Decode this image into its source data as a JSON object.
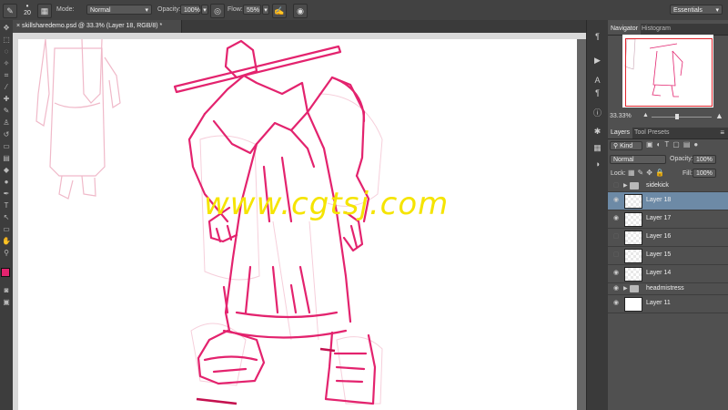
{
  "options_bar": {
    "brush_size": "20",
    "mode_label": "Mode:",
    "mode_value": "Normal",
    "opacity_label": "Opacity:",
    "opacity_value": "100%",
    "flow_label": "Flow:",
    "flow_value": "55%",
    "workspace": "Essentials"
  },
  "document": {
    "tab_title": "skillsharedemo.psd @ 33.3% (Layer 18, RGB/8) *"
  },
  "navigator": {
    "tabs": [
      "Navigator",
      "Histogram"
    ],
    "zoom": "33.33%"
  },
  "layers_panel": {
    "tabs": [
      "Layers",
      "Tool Presets"
    ],
    "filter_kind": "Kind",
    "blend_mode": "Normal",
    "opacity_label": "Opacity:",
    "opacity_value": "100%",
    "lock_label": "Lock:",
    "fill_label": "Fill:",
    "fill_value": "100%",
    "layers": [
      {
        "name": "sidekick",
        "type": "group"
      },
      {
        "name": "Layer 18",
        "type": "layer",
        "selected": true
      },
      {
        "name": "Layer 17",
        "type": "layer"
      },
      {
        "name": "Layer 16",
        "type": "layer"
      },
      {
        "name": "Layer 15",
        "type": "layer"
      },
      {
        "name": "Layer 14",
        "type": "layer"
      },
      {
        "name": "headmistress",
        "type": "group"
      },
      {
        "name": "Layer 11",
        "type": "layer"
      }
    ]
  },
  "canvas": {
    "watermark": "www.cgtsj.com",
    "stroke_color": "#e3236e"
  }
}
